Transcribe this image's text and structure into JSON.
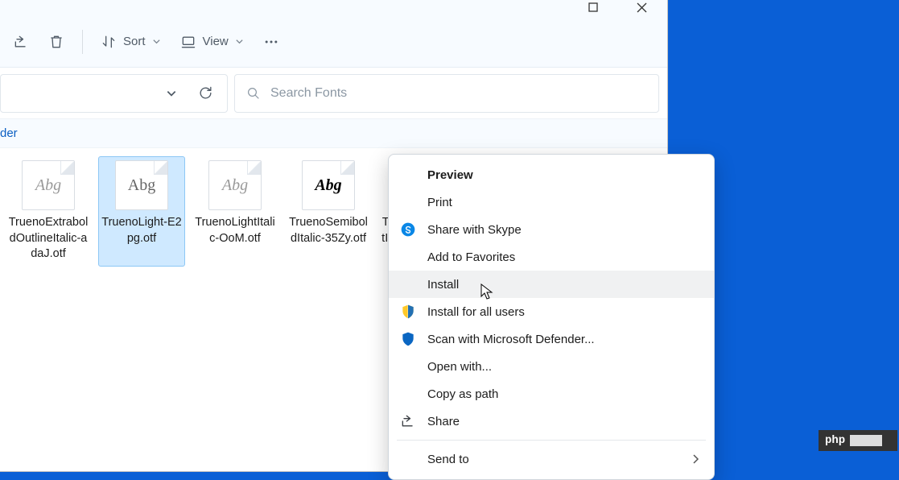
{
  "toolbar": {
    "sort_label": "Sort",
    "view_label": "View"
  },
  "search": {
    "placeholder": "Search Fonts"
  },
  "breadcrumb": {
    "tail": "der"
  },
  "files": [
    {
      "name": "TruenoExtraboldOutlineItalic-adaJ.otf",
      "style": "italic"
    },
    {
      "name": "TruenoLight-E2pg.otf",
      "style": "light",
      "selected": true
    },
    {
      "name": "TruenoLightItalic-OoM.otf",
      "style": "italic"
    },
    {
      "name": "TruenoSemiboldItalic-35Zy.otf",
      "style": "bold"
    },
    {
      "name": "TruenoUltralightItalic-AYmD.otf",
      "style": "italic"
    }
  ],
  "context_menu": {
    "items": [
      {
        "label": "Preview",
        "bold": true
      },
      {
        "label": "Print"
      },
      {
        "label": "Share with Skype",
        "icon": "skype"
      },
      {
        "label": "Add to Favorites"
      },
      {
        "label": "Install",
        "hovered": true
      },
      {
        "label": "Install for all users",
        "icon": "shield-yellow"
      },
      {
        "label": "Scan with Microsoft Defender...",
        "icon": "shield-blue"
      },
      {
        "label": "Open with..."
      },
      {
        "label": "Copy as path"
      },
      {
        "label": "Share",
        "icon": "share"
      }
    ],
    "footer": {
      "label": "Send to",
      "submenu": true
    }
  },
  "abg_sample": "Abg",
  "watermark": {
    "text": "php"
  }
}
